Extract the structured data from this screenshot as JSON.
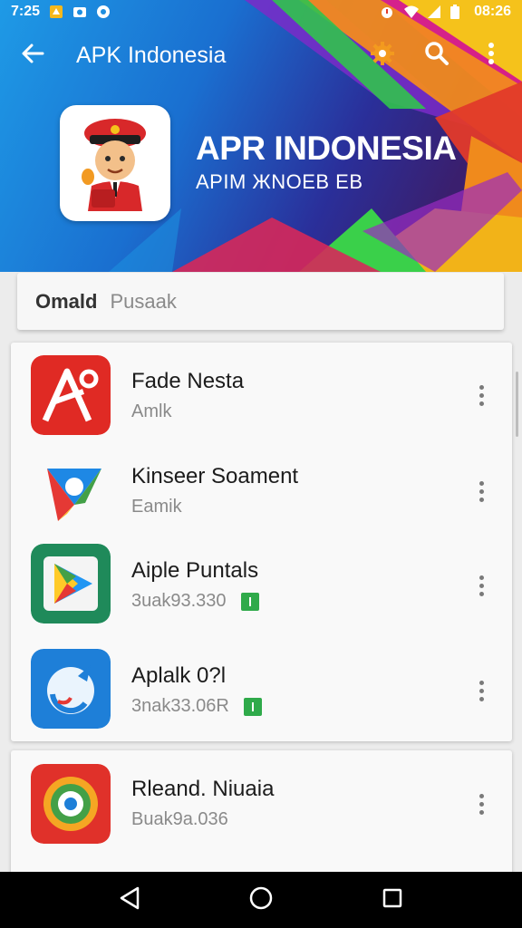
{
  "status_bar": {
    "time": "7:25",
    "clock_right": "08:26",
    "left_icons": [
      "notification-app-icon",
      "camera-icon",
      "circle-app-icon"
    ],
    "right_icons": [
      "alarm-icon",
      "wifi-icon",
      "signal-icon",
      "battery-icon"
    ]
  },
  "app_bar": {
    "title": "APK Indonesia",
    "back_icon": "arrow-back-icon",
    "actions": [
      "gear-icon",
      "search-icon",
      "overflow-menu-icon"
    ]
  },
  "hero": {
    "title": "APR INDONESIA",
    "subtitle": "APIM ЖNOEB EB",
    "logo_icon": "mascot-logo-icon"
  },
  "search": {
    "label": "Omald",
    "placeholder": "Pusaak"
  },
  "apps": [
    {
      "name": "Fade Nesta",
      "sub": "Amlk",
      "badge": false,
      "icon": "red-a-app-icon"
    },
    {
      "name": "Kinseer Soament",
      "sub": "Eamik",
      "badge": false,
      "icon": "colorful-triangle-app-icon"
    },
    {
      "name": "Aiple Puntals",
      "sub": "3uak93.330",
      "badge": true,
      "icon": "play-store-app-icon"
    },
    {
      "name": "Aplalk 0?l",
      "sub": "3nak33.06R",
      "badge": true,
      "icon": "blue-circle-app-icon"
    },
    {
      "name": "Rleand. Niuaia",
      "sub": "Buak9a.036",
      "badge": false,
      "icon": "target-app-icon"
    }
  ],
  "nav_bar": {
    "buttons": [
      "back-triangle-icon",
      "home-circle-icon",
      "recents-square-icon"
    ]
  },
  "colors": {
    "badge_green": "#2faa4a",
    "hero_blue": "#1e9ae6",
    "hero_navy": "#2a2f9a"
  }
}
